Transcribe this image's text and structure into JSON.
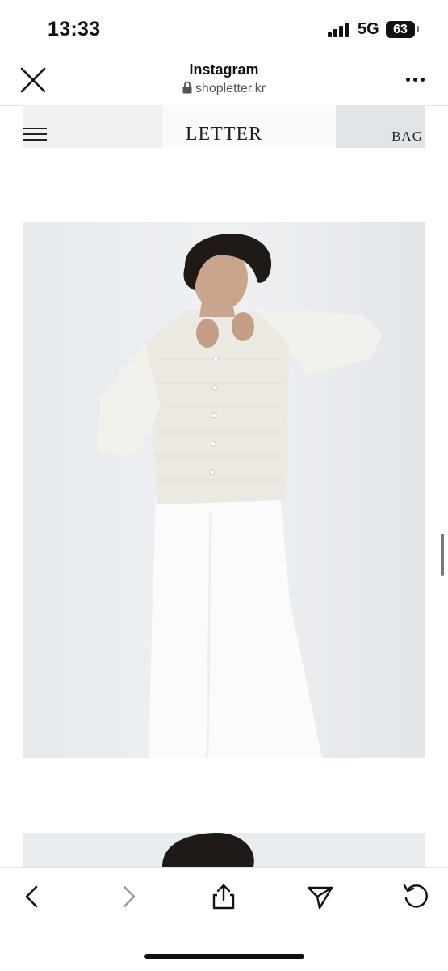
{
  "status_bar": {
    "time": "13:33",
    "network": "5G",
    "battery": "63"
  },
  "browser": {
    "title": "Instagram",
    "url": "shopletter.kr",
    "icons": {
      "close": "close-icon",
      "lock": "lock-icon",
      "more": "more-icon"
    }
  },
  "site_nav": {
    "brand": "LETTER",
    "bag_label": "BAG",
    "menu_icon": "hamburger-menu-icon"
  },
  "toolbar": {
    "icons": [
      "back-icon",
      "forward-icon",
      "share-icon",
      "send-icon",
      "reload-icon"
    ]
  }
}
